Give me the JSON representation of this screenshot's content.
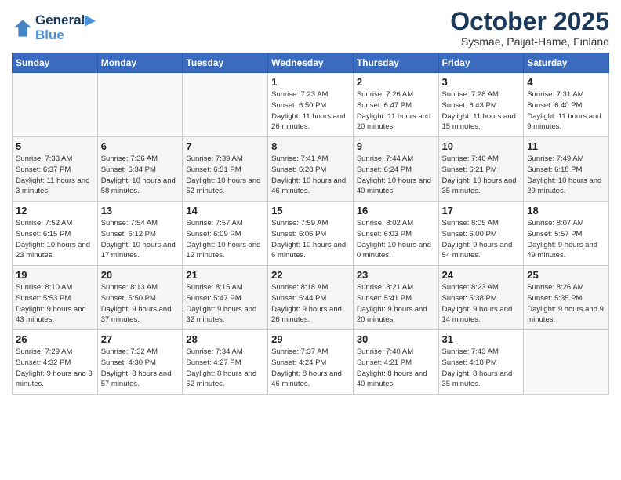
{
  "header": {
    "logo_line1": "General",
    "logo_line2": "Blue",
    "month": "October 2025",
    "location": "Sysmae, Paijat-Hame, Finland"
  },
  "weekdays": [
    "Sunday",
    "Monday",
    "Tuesday",
    "Wednesday",
    "Thursday",
    "Friday",
    "Saturday"
  ],
  "weeks": [
    [
      {
        "day": "",
        "info": ""
      },
      {
        "day": "",
        "info": ""
      },
      {
        "day": "",
        "info": ""
      },
      {
        "day": "1",
        "info": "Sunrise: 7:23 AM\nSunset: 6:50 PM\nDaylight: 11 hours\nand 26 minutes."
      },
      {
        "day": "2",
        "info": "Sunrise: 7:26 AM\nSunset: 6:47 PM\nDaylight: 11 hours\nand 20 minutes."
      },
      {
        "day": "3",
        "info": "Sunrise: 7:28 AM\nSunset: 6:43 PM\nDaylight: 11 hours\nand 15 minutes."
      },
      {
        "day": "4",
        "info": "Sunrise: 7:31 AM\nSunset: 6:40 PM\nDaylight: 11 hours\nand 9 minutes."
      }
    ],
    [
      {
        "day": "5",
        "info": "Sunrise: 7:33 AM\nSunset: 6:37 PM\nDaylight: 11 hours\nand 3 minutes."
      },
      {
        "day": "6",
        "info": "Sunrise: 7:36 AM\nSunset: 6:34 PM\nDaylight: 10 hours\nand 58 minutes."
      },
      {
        "day": "7",
        "info": "Sunrise: 7:39 AM\nSunset: 6:31 PM\nDaylight: 10 hours\nand 52 minutes."
      },
      {
        "day": "8",
        "info": "Sunrise: 7:41 AM\nSunset: 6:28 PM\nDaylight: 10 hours\nand 46 minutes."
      },
      {
        "day": "9",
        "info": "Sunrise: 7:44 AM\nSunset: 6:24 PM\nDaylight: 10 hours\nand 40 minutes."
      },
      {
        "day": "10",
        "info": "Sunrise: 7:46 AM\nSunset: 6:21 PM\nDaylight: 10 hours\nand 35 minutes."
      },
      {
        "day": "11",
        "info": "Sunrise: 7:49 AM\nSunset: 6:18 PM\nDaylight: 10 hours\nand 29 minutes."
      }
    ],
    [
      {
        "day": "12",
        "info": "Sunrise: 7:52 AM\nSunset: 6:15 PM\nDaylight: 10 hours\nand 23 minutes."
      },
      {
        "day": "13",
        "info": "Sunrise: 7:54 AM\nSunset: 6:12 PM\nDaylight: 10 hours\nand 17 minutes."
      },
      {
        "day": "14",
        "info": "Sunrise: 7:57 AM\nSunset: 6:09 PM\nDaylight: 10 hours\nand 12 minutes."
      },
      {
        "day": "15",
        "info": "Sunrise: 7:59 AM\nSunset: 6:06 PM\nDaylight: 10 hours\nand 6 minutes."
      },
      {
        "day": "16",
        "info": "Sunrise: 8:02 AM\nSunset: 6:03 PM\nDaylight: 10 hours\nand 0 minutes."
      },
      {
        "day": "17",
        "info": "Sunrise: 8:05 AM\nSunset: 6:00 PM\nDaylight: 9 hours\nand 54 minutes."
      },
      {
        "day": "18",
        "info": "Sunrise: 8:07 AM\nSunset: 5:57 PM\nDaylight: 9 hours\nand 49 minutes."
      }
    ],
    [
      {
        "day": "19",
        "info": "Sunrise: 8:10 AM\nSunset: 5:53 PM\nDaylight: 9 hours\nand 43 minutes."
      },
      {
        "day": "20",
        "info": "Sunrise: 8:13 AM\nSunset: 5:50 PM\nDaylight: 9 hours\nand 37 minutes."
      },
      {
        "day": "21",
        "info": "Sunrise: 8:15 AM\nSunset: 5:47 PM\nDaylight: 9 hours\nand 32 minutes."
      },
      {
        "day": "22",
        "info": "Sunrise: 8:18 AM\nSunset: 5:44 PM\nDaylight: 9 hours\nand 26 minutes."
      },
      {
        "day": "23",
        "info": "Sunrise: 8:21 AM\nSunset: 5:41 PM\nDaylight: 9 hours\nand 20 minutes."
      },
      {
        "day": "24",
        "info": "Sunrise: 8:23 AM\nSunset: 5:38 PM\nDaylight: 9 hours\nand 14 minutes."
      },
      {
        "day": "25",
        "info": "Sunrise: 8:26 AM\nSunset: 5:35 PM\nDaylight: 9 hours\nand 9 minutes."
      }
    ],
    [
      {
        "day": "26",
        "info": "Sunrise: 7:29 AM\nSunset: 4:32 PM\nDaylight: 9 hours\nand 3 minutes."
      },
      {
        "day": "27",
        "info": "Sunrise: 7:32 AM\nSunset: 4:30 PM\nDaylight: 8 hours\nand 57 minutes."
      },
      {
        "day": "28",
        "info": "Sunrise: 7:34 AM\nSunset: 4:27 PM\nDaylight: 8 hours\nand 52 minutes."
      },
      {
        "day": "29",
        "info": "Sunrise: 7:37 AM\nSunset: 4:24 PM\nDaylight: 8 hours\nand 46 minutes."
      },
      {
        "day": "30",
        "info": "Sunrise: 7:40 AM\nSunset: 4:21 PM\nDaylight: 8 hours\nand 40 minutes."
      },
      {
        "day": "31",
        "info": "Sunrise: 7:43 AM\nSunset: 4:18 PM\nDaylight: 8 hours\nand 35 minutes."
      },
      {
        "day": "",
        "info": ""
      }
    ]
  ]
}
